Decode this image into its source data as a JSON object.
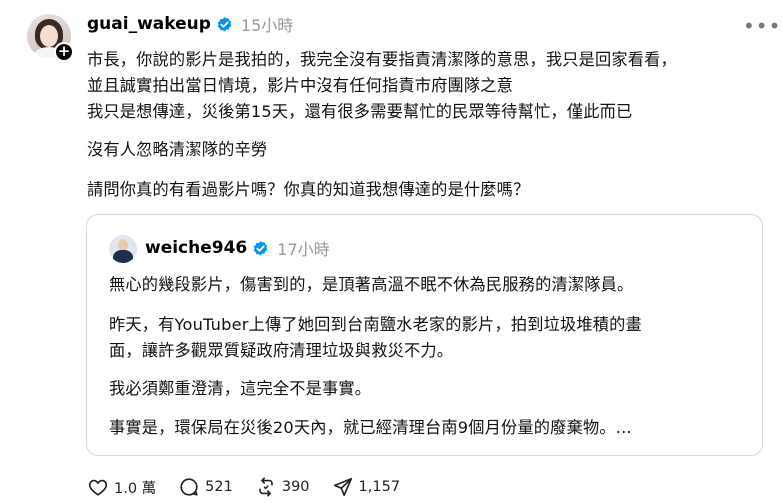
{
  "post": {
    "username": "guai_wakeup",
    "time": "15小時",
    "lines": [
      "市長，你說的影片是我拍的，我完全沒有要指責清潔隊的意思，我只是回家看看，",
      "並且誠實拍出當日情境，影片中沒有任何指責市府團隊之意",
      "我只是想傳達，災後第15天，還有很多需要幫忙的民眾等待幫忙，僅此而已",
      "沒有人忽略清潔隊的辛勞",
      "請問你真的有看過影片嗎？你真的知道我想傳達的是什麼嗎？"
    ]
  },
  "quote": {
    "username": "weiche946",
    "time": "17小時",
    "lines": [
      "無心的幾段影片，傷害到的，是頂著高溫不眠不休為民服務的清潔隊員。",
      "昨天，有YouTuber上傳了她回到台南鹽水老家的影片，拍到垃圾堆積的畫",
      "面，讓許多觀眾質疑政府清理垃圾與救災不力。",
      "我必須鄭重澄清，這完全不是事實。",
      "事實是，環保局在災後20天內，就已經清理台南9個月份量的廢棄物。..."
    ]
  },
  "actions": {
    "likes": "1.0 萬",
    "replies": "521",
    "reposts": "390",
    "shares": "1,157"
  },
  "icons": {
    "verified": "verified-badge-icon",
    "more": "more-icon",
    "follow": "plus-icon",
    "like": "heart-icon",
    "reply": "comment-icon",
    "repost": "repost-icon",
    "share": "share-icon"
  },
  "colors": {
    "verified": "#0095f6",
    "muted": "#999999",
    "border": "#d8d8d8"
  }
}
